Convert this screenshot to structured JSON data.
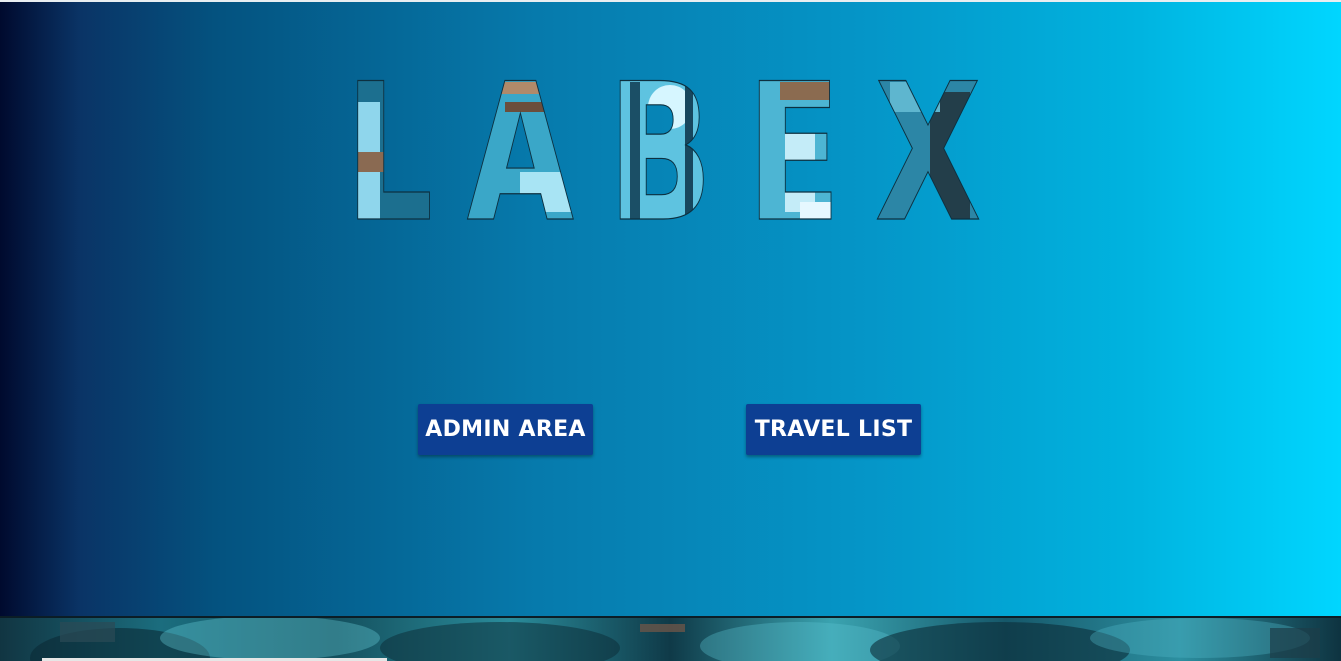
{
  "app": {
    "logo_text": "LABEX"
  },
  "actions": {
    "admin_label": "ADMIN AREA",
    "travel_label": "TRAVEL LIST"
  },
  "colors": {
    "gradient_start": "#000a2e",
    "gradient_end": "#00d6ff",
    "button_bg": "#0d3f93",
    "button_text": "#ffffff"
  },
  "icons": {
    "logo": "labex-logo-image-lettering"
  }
}
